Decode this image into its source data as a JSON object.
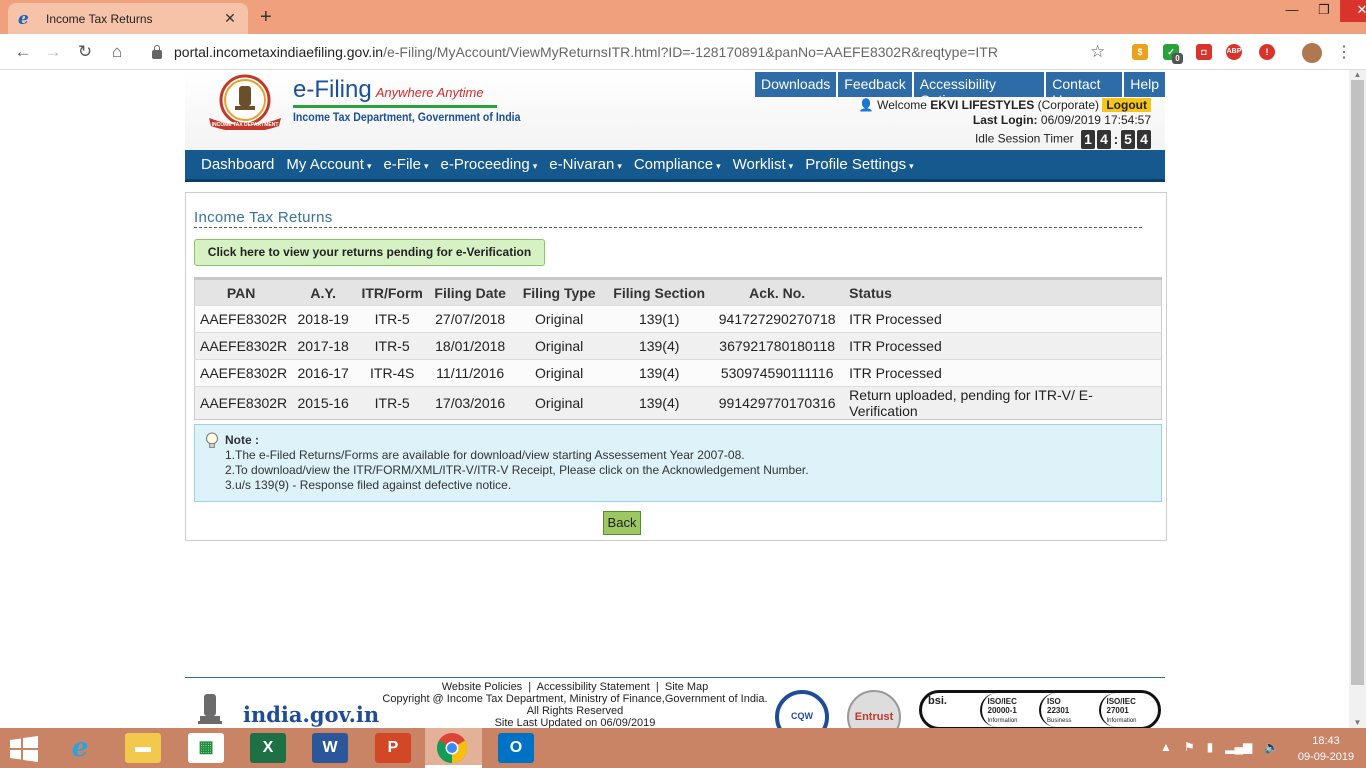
{
  "browser": {
    "tab_title": "Income Tax Returns",
    "url_host": "portal.incometaxindiaefiling.gov.in",
    "url_path": "/e-Filing/MyAccount/ViewMyReturnsITR.html?ID=-128170891&panNo=AAEFE8302R&reqtype=ITR",
    "ext_badge_count": "0",
    "abp_label": "ABP"
  },
  "header": {
    "brand": "e-Filing",
    "tagline": "Anywhere Anytime",
    "dept": "Income Tax Department, Government of India",
    "emblem_text": "INCOME TAX DEPARTMENT",
    "topnav": [
      "Downloads",
      "Feedback",
      "Accessibility Options",
      "Contact Us",
      "Help"
    ],
    "welcome_prefix": "Welcome",
    "user": "EKVI LIFESTYLES",
    "user_type": "(Corporate)",
    "logout": "Logout",
    "last_login_label": "Last Login:",
    "last_login": "06/09/2019 17:54:57",
    "idle_label": "Idle Session Timer",
    "timer": [
      "1",
      "4",
      "5",
      "4"
    ]
  },
  "mainnav": [
    "Dashboard",
    "My Account",
    "e-File",
    "e-Proceeding",
    "e-Nivaran",
    "Compliance",
    "Worklist",
    "Profile Settings"
  ],
  "page": {
    "title": "Income Tax Returns",
    "pending_button": "Click here to view your returns pending for e-Verification",
    "columns": [
      "PAN",
      "A.Y.",
      "ITR/Form",
      "Filing Date",
      "Filing Type",
      "Filing Section",
      "Ack. No.",
      "Status"
    ],
    "rows": [
      [
        "AAEFE8302R",
        "2018-19",
        "ITR-5",
        "27/07/2018",
        "Original",
        "139(1)",
        "941727290270718",
        "ITR Processed"
      ],
      [
        "AAEFE8302R",
        "2017-18",
        "ITR-5",
        "18/01/2018",
        "Original",
        "139(4)",
        "367921780180118",
        "ITR Processed"
      ],
      [
        "AAEFE8302R",
        "2016-17",
        "ITR-4S",
        "11/11/2016",
        "Original",
        "139(4)",
        "530974590111116",
        "ITR Processed"
      ],
      [
        "AAEFE8302R",
        "2015-16",
        "ITR-5",
        "17/03/2016",
        "Original",
        "139(4)",
        "991429770170316",
        "Return uploaded, pending for ITR-V/ E-Verification"
      ]
    ],
    "note_title": "Note :",
    "notes": [
      "1.The e-Filed Returns/Forms are available for download/view starting Assessement Year 2007-08.",
      "2.To download/view the ITR/FORM/XML/ITR-V/ITR-V Receipt, Please click on the Acknowledgement Number.",
      "3.u/s 139(9) - Response filed against defective notice."
    ],
    "back": "Back"
  },
  "footer": {
    "links": [
      "Website Policies",
      "Accessibility Statement",
      "Site Map"
    ],
    "copyright": "Copyright @ Income Tax Department, Ministry of Finance,Government of India.",
    "rights": "All Rights Reserved",
    "updated": "Site Last Updated on 06/09/2019",
    "india_gov": "india.gov.in",
    "badges": [
      "CQW",
      "Entrust"
    ],
    "bsi": "bsi.",
    "iso": [
      {
        "std": "ISO/IEC",
        "num": "20000-1",
        "desc": "Information Technology Service"
      },
      {
        "std": "ISO",
        "num": "22301",
        "desc": "Business Continuity"
      },
      {
        "std": "ISO/IEC",
        "num": "27001",
        "desc": "Information Security Management"
      }
    ]
  },
  "taskbar": {
    "time": "18:43",
    "date": "09-09-2019",
    "apps": [
      "internet-explorer",
      "file-explorer",
      "microsoft-store",
      "excel",
      "word",
      "powerpoint",
      "chrome",
      "outlook"
    ]
  }
}
